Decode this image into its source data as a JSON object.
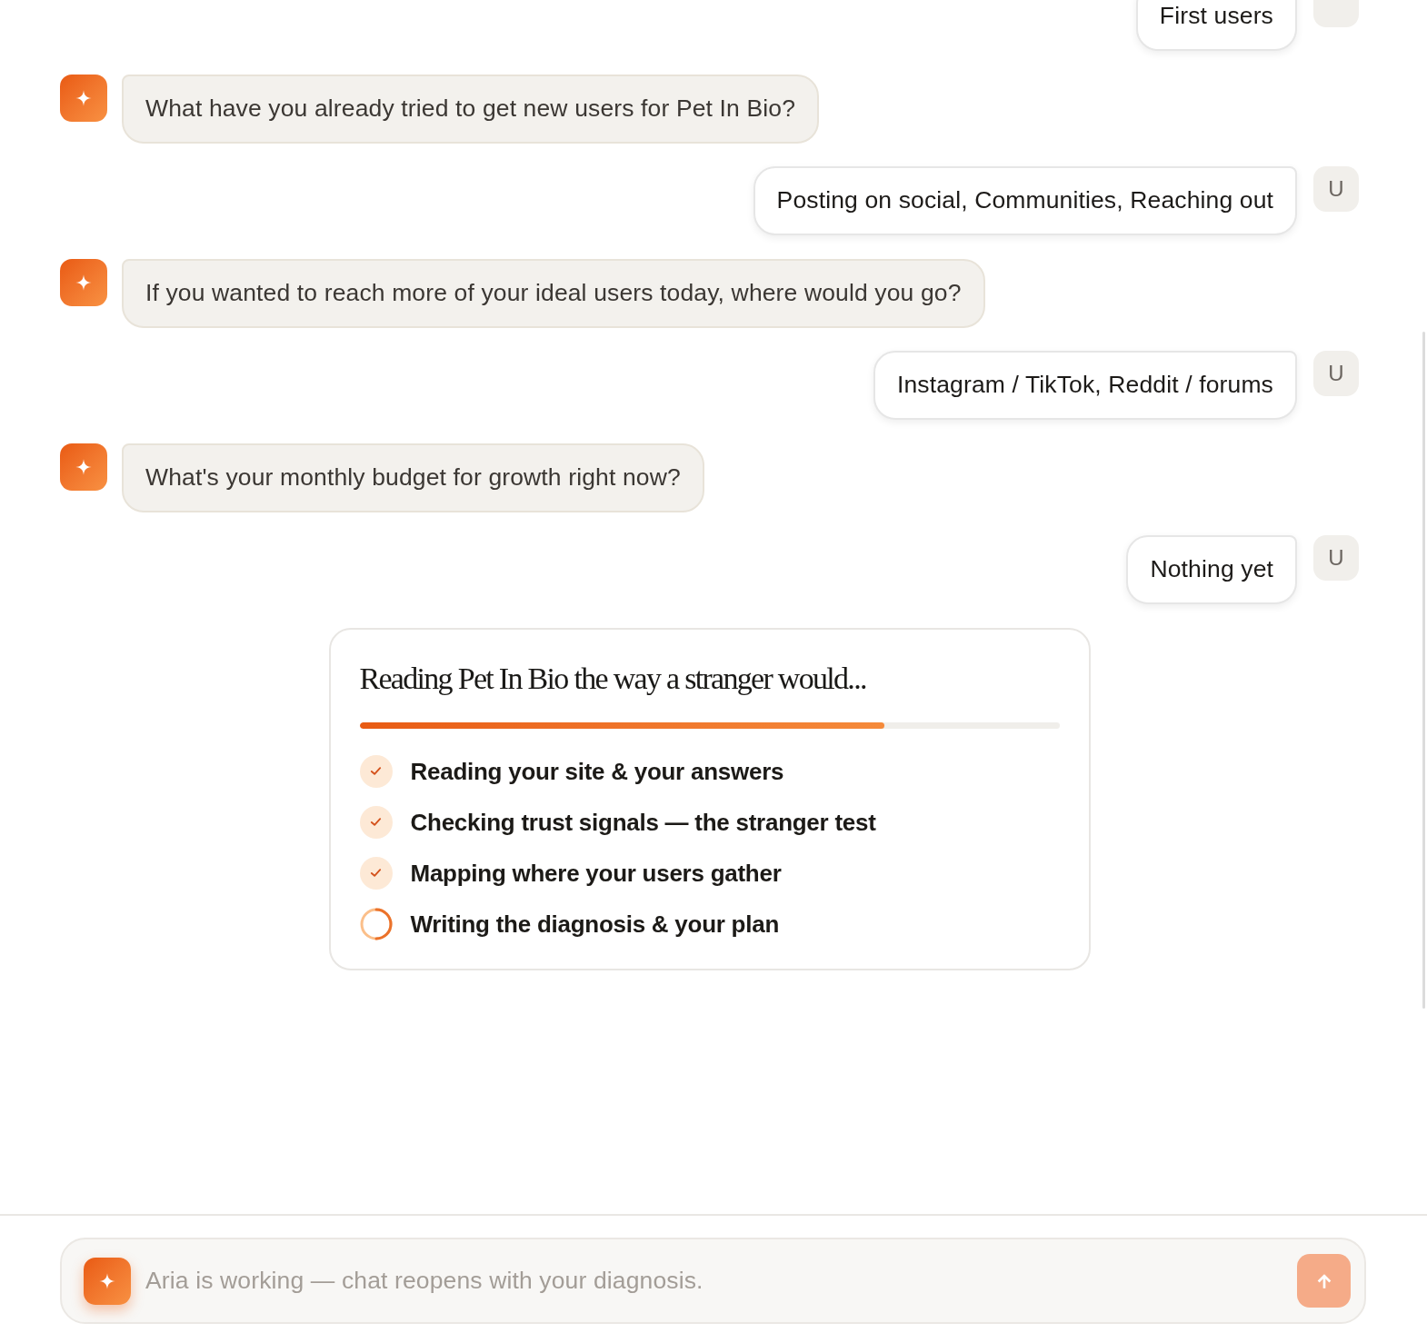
{
  "messages": [
    {
      "kind": "user",
      "text": "First users"
    },
    {
      "kind": "assistant",
      "text": "What have you already tried to get new users for Pet In Bio?"
    },
    {
      "kind": "user",
      "text": "Posting on social, Communities, Reaching out",
      "avatar": "U"
    },
    {
      "kind": "assistant",
      "text": "If you wanted to reach more of your ideal users today, where would you go?"
    },
    {
      "kind": "user",
      "text": "Instagram / TikTok, Reddit / forums",
      "avatar": "U"
    },
    {
      "kind": "assistant",
      "text": "What's your monthly budget for growth right now?"
    },
    {
      "kind": "user",
      "text": "Nothing yet",
      "avatar": "U"
    }
  ],
  "progress_card": {
    "title": "Reading Pet In Bio the way a stranger would...",
    "progress": {
      "level": 0.75
    },
    "steps": [
      {
        "label": "Reading your site & your answers",
        "done": true
      },
      {
        "label": "Checking trust signals — the stranger test",
        "done": true
      },
      {
        "label": "Mapping where your users gather",
        "done": true
      },
      {
        "label": "Writing the diagnosis & your plan",
        "done": false
      }
    ]
  },
  "composer": {
    "placeholder": "Aria is working — chat reopens with your diagnosis.",
    "send_disabled": true
  }
}
